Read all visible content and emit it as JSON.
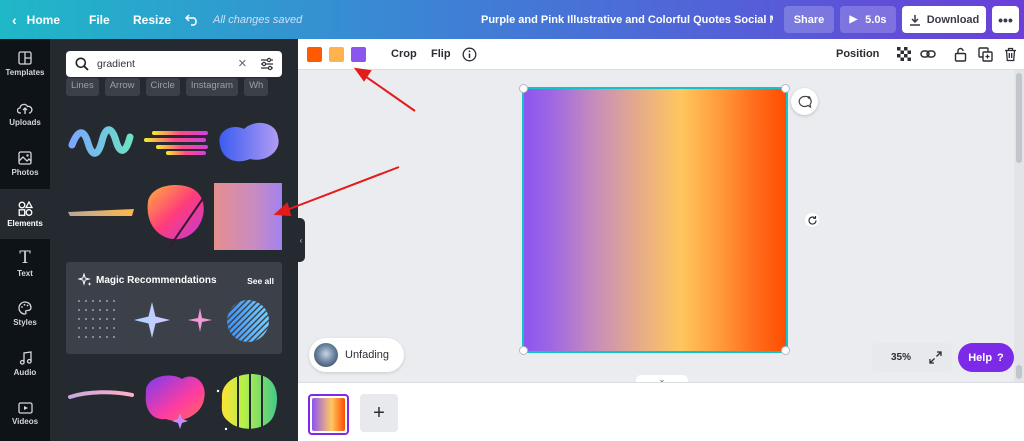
{
  "topbar": {
    "home": "Home",
    "file": "File",
    "resize": "Resize",
    "saved_status": "All changes saved",
    "title": "Purple and Pink Illustrative and Colorful Quotes Social Medi...",
    "share": "Share",
    "play": "5.0s",
    "download": "Download"
  },
  "sidenav": {
    "items": [
      {
        "label": "Templates",
        "icon": "templates-icon"
      },
      {
        "label": "Uploads",
        "icon": "upload-cloud-icon"
      },
      {
        "label": "Photos",
        "icon": "photo-icon"
      },
      {
        "label": "Elements",
        "icon": "shapes-icon"
      },
      {
        "label": "Text",
        "icon": "text-icon"
      },
      {
        "label": "Styles",
        "icon": "palette-icon"
      },
      {
        "label": "Audio",
        "icon": "music-note-icon"
      },
      {
        "label": "Videos",
        "icon": "video-icon"
      }
    ],
    "active": "Elements"
  },
  "panel": {
    "search_value": "gradient",
    "chips": [
      "Lines",
      "Arrow",
      "Circle",
      "Instagram",
      "Wh"
    ],
    "magic_title": "Magic Recommendations",
    "see_all": "See all"
  },
  "toolbar": {
    "colors": [
      "#ff5a00",
      "#ffb24d",
      "#8b55f0"
    ],
    "crop": "Crop",
    "flip": "Flip",
    "position": "Position"
  },
  "canvas": {
    "audio_label": "Unfading",
    "zoom": "35%",
    "help": "Help",
    "help_icon": "?",
    "add_page": "+"
  },
  "colors": {
    "accent": "#7d2ae8",
    "selection": "#13c3cc",
    "annotation_arrow": "#e31b1b"
  }
}
